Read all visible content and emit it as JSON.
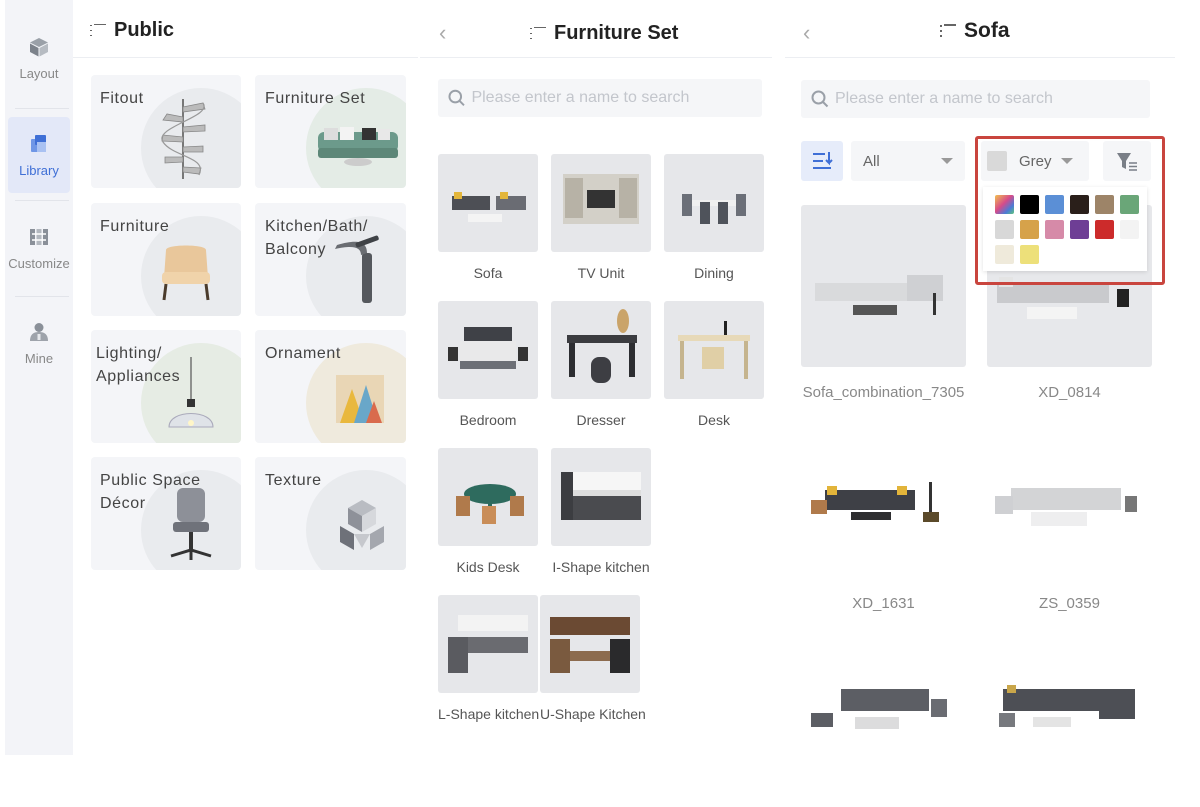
{
  "rail": {
    "items": [
      {
        "label": "Layout",
        "icon": "cube-icon"
      },
      {
        "label": "Library",
        "icon": "library-icon",
        "active": true
      },
      {
        "label": "Customize",
        "icon": "customize-icon"
      },
      {
        "label": "Mine",
        "icon": "user-icon"
      }
    ]
  },
  "public": {
    "title": "Public",
    "categories": [
      {
        "label": "Fitout"
      },
      {
        "label": "Furniture Set"
      },
      {
        "label": "Furniture"
      },
      {
        "label": "Kitchen/Bath/ Balcony"
      },
      {
        "label": "Lighting/ Appliances"
      },
      {
        "label": "Ornament"
      },
      {
        "label": "Public Space Décor"
      },
      {
        "label": "Texture"
      }
    ]
  },
  "furniture_set": {
    "title": "Furniture Set",
    "back": "‹",
    "search_placeholder": "Please enter a name to search",
    "items": [
      {
        "label": "Sofa"
      },
      {
        "label": "TV Unit"
      },
      {
        "label": "Dining"
      },
      {
        "label": "Bedroom"
      },
      {
        "label": "Dresser"
      },
      {
        "label": "Desk"
      },
      {
        "label": "Kids Desk"
      },
      {
        "label": "I-Shape kitchen"
      },
      {
        "label": "L-Shape kitchen"
      },
      {
        "label": "U-Shape Kitchen"
      }
    ]
  },
  "sofa": {
    "title": "Sofa",
    "back": "‹",
    "search_placeholder": "Please enter a name to search",
    "type_filter": "All",
    "color_filter": "Grey",
    "color_filter_swatch": "#d9d9d9",
    "palette": [
      "gradient",
      "#000000",
      "#5b8fd6",
      "#2a1f1a",
      "#9d8468",
      "#6aa678",
      "#d8d8d8",
      "#d6a24a",
      "#d68aa8",
      "#6e3e95",
      "#cc2b2b",
      "#f3f3f3",
      "#efeadb",
      "#ede07a"
    ],
    "products": [
      {
        "name": "Sofa_combination_7305"
      },
      {
        "name": "XD_0814"
      },
      {
        "name": "XD_1631"
      },
      {
        "name": "ZS_0359"
      },
      {
        "name": ""
      },
      {
        "name": ""
      }
    ]
  }
}
